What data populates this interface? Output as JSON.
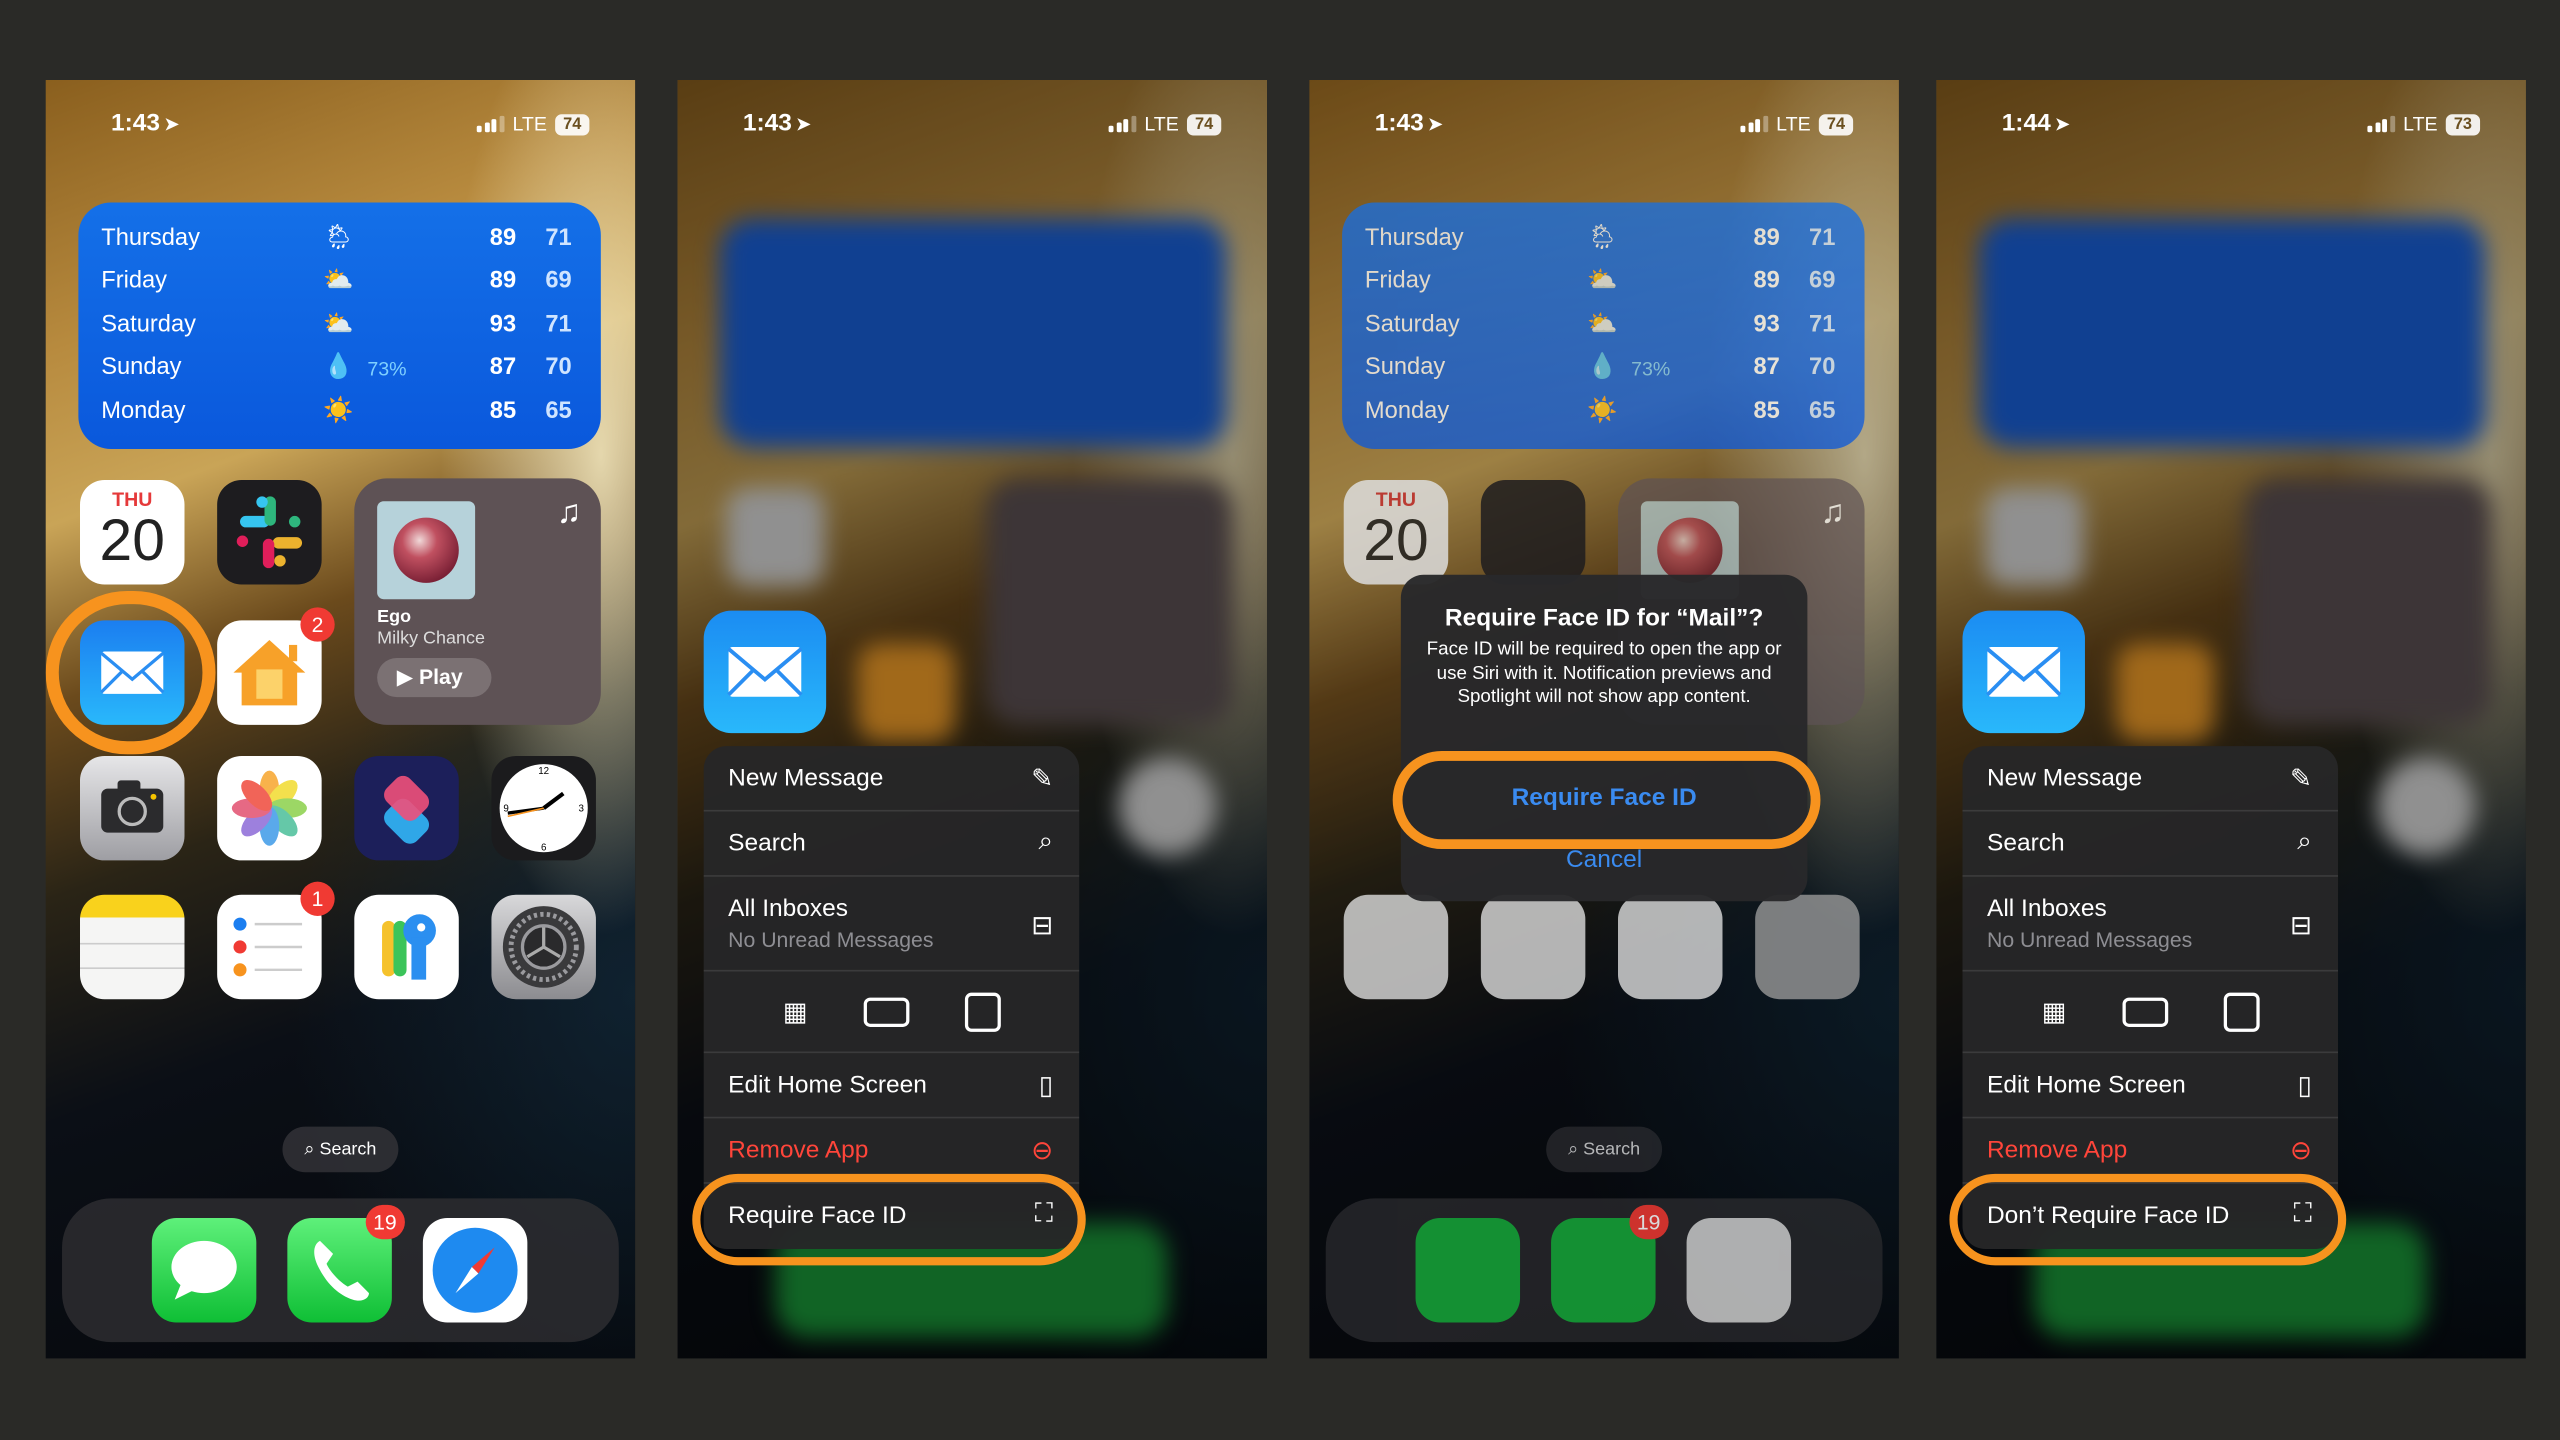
{
  "panels": [
    {
      "status": {
        "time": "1:43",
        "network": "LTE",
        "battery": "74"
      },
      "weather": {
        "rows": [
          {
            "day": "Thursday",
            "icon": "rain-cloud-sun-icon",
            "precip": "",
            "hi": "89",
            "lo": "71"
          },
          {
            "day": "Friday",
            "icon": "sun-cloud-icon",
            "precip": "",
            "hi": "89",
            "lo": "69"
          },
          {
            "day": "Saturday",
            "icon": "partly-cloudy-icon",
            "precip": "",
            "hi": "93",
            "lo": "71"
          },
          {
            "day": "Sunday",
            "icon": "raindrop-icon",
            "precip": "73%",
            "hi": "87",
            "lo": "70"
          },
          {
            "day": "Monday",
            "icon": "sun-icon",
            "precip": "",
            "hi": "85",
            "lo": "65"
          }
        ]
      },
      "calendar": {
        "weekday": "THU",
        "date": "20"
      },
      "music": {
        "song": "Ego",
        "artist": "Milky Chance",
        "play_label": "Play"
      },
      "badges": {
        "home": "2",
        "reminders": "1",
        "phone": "19"
      },
      "search_label": "Search"
    },
    {
      "status": {
        "time": "1:43",
        "network": "LTE",
        "battery": "74"
      }
    },
    {
      "status": {
        "time": "1:43",
        "network": "LTE",
        "battery": "74"
      }
    },
    {
      "status": {
        "time": "1:44",
        "network": "LTE",
        "battery": "73"
      }
    }
  ],
  "context_menu": {
    "items": [
      {
        "label": "New Message",
        "icon": "compose-icon"
      },
      {
        "label": "Search",
        "icon": "search-icon"
      },
      {
        "label": "All Inboxes",
        "sublabel": "No Unread Messages",
        "icon": "inbox-tray-icon"
      },
      {
        "label": "Edit Home Screen",
        "icon": "phone-grid-icon"
      },
      {
        "label": "Remove App",
        "icon": "minus-circle-icon",
        "destructive": true
      }
    ],
    "require_label": "Require Face ID",
    "dont_require_label": "Don’t Require Face ID"
  },
  "alert": {
    "title": "Require Face ID for “Mail”?",
    "message": "Face ID will be required to open the app or use Siri with it. Notification previews and Spotlight will not show app content.",
    "confirm_label": "Require Face ID",
    "cancel_label": "Cancel"
  },
  "colors": {
    "highlight": "#f7931e",
    "accent_blue": "#3a8bf0",
    "destructive": "#ff453a",
    "badge": "#f03a33"
  }
}
